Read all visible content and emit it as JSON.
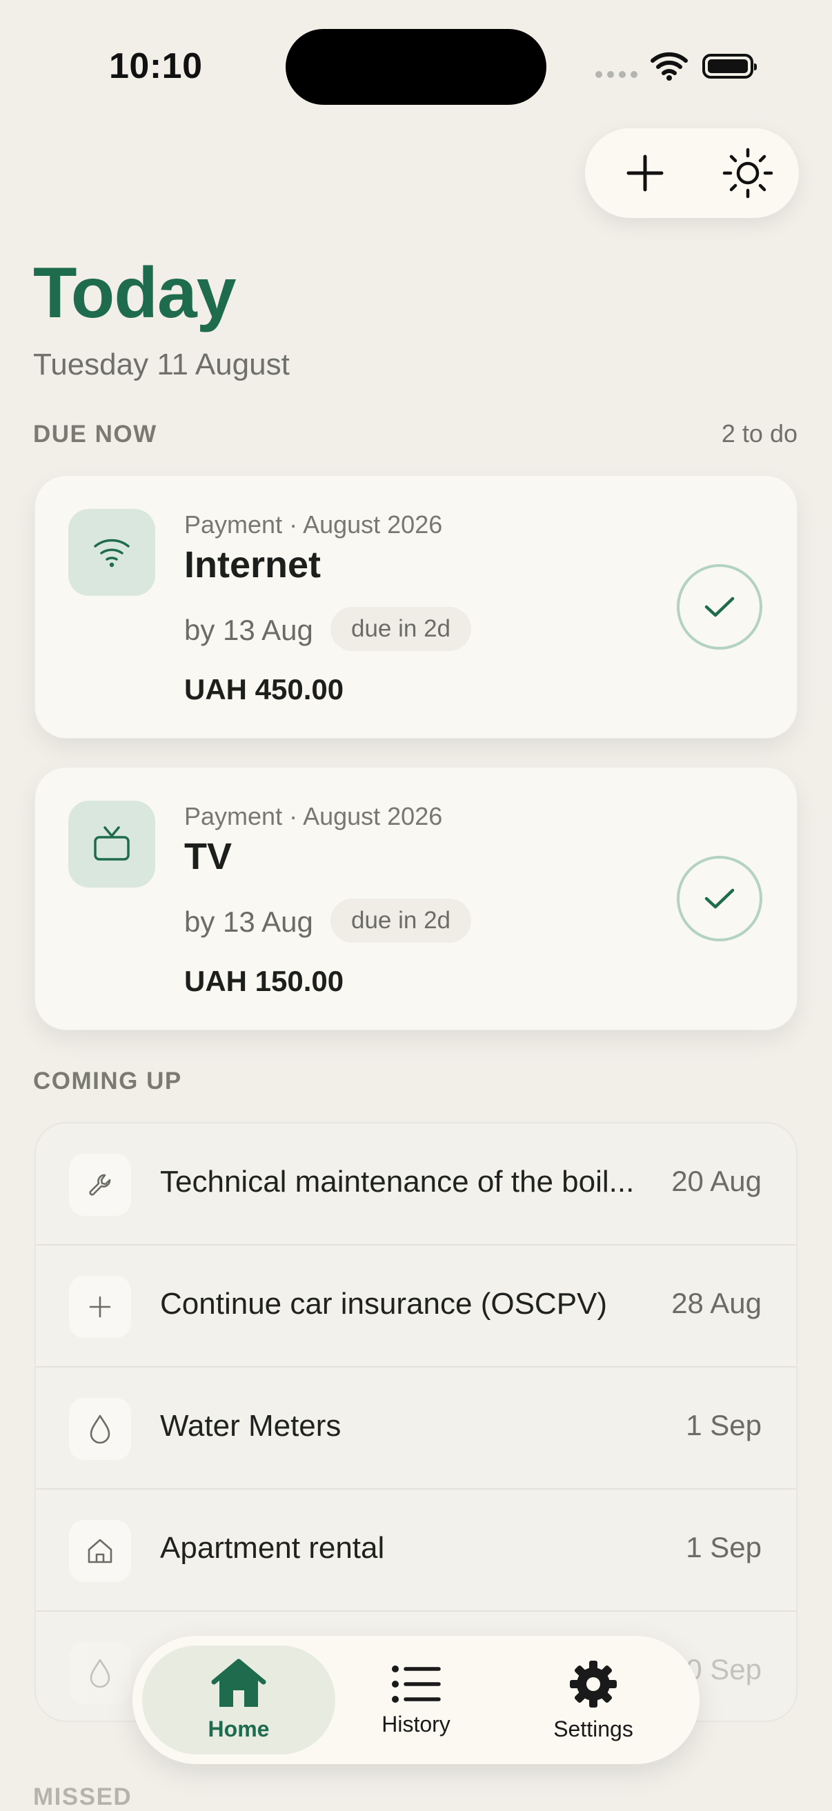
{
  "status_bar": {
    "time": "10:10"
  },
  "header": {
    "title": "Today",
    "date": "Tuesday 11 August",
    "actions": {
      "add_icon": "plus-icon",
      "theme_icon": "sun-icon"
    }
  },
  "due_now": {
    "label": "DUE NOW",
    "count": "2 to do",
    "items": [
      {
        "icon": "wifi-icon",
        "meta": "Payment · August 2026",
        "name": "Internet",
        "due_by": "by 13 Aug",
        "badge": "due in 2d",
        "amount": "UAH 450.00"
      },
      {
        "icon": "tv-icon",
        "meta": "Payment · August 2026",
        "name": "TV",
        "due_by": "by 13 Aug",
        "badge": "due in 2d",
        "amount": "UAH 150.00"
      }
    ]
  },
  "coming_up": {
    "label": "COMING UP",
    "items": [
      {
        "icon": "wrench-icon",
        "name": "Technical maintenance of the boil...",
        "date": "20 Aug"
      },
      {
        "icon": "plus-icon",
        "name": "Continue car insurance (OSCPV)",
        "date": "28 Aug"
      },
      {
        "icon": "drop-icon",
        "name": "Water Meters",
        "date": "1 Sep"
      },
      {
        "icon": "house-icon",
        "name": "Apartment rental",
        "date": "1 Sep"
      },
      {
        "icon": "drop-icon",
        "name": "",
        "date": "0 Sep"
      }
    ]
  },
  "missed": {
    "label": "MISSED"
  },
  "tabbar": {
    "tabs": [
      {
        "label": "Home",
        "icon": "house-icon",
        "active": true
      },
      {
        "label": "History",
        "icon": "list-icon",
        "active": false
      },
      {
        "label": "Settings",
        "icon": "gear-icon",
        "active": false
      }
    ]
  },
  "colors": {
    "accent": "#1e6b4d",
    "background": "#f1efe8",
    "card": "#f9f8f3",
    "icon_tile": "#d9e7de"
  }
}
